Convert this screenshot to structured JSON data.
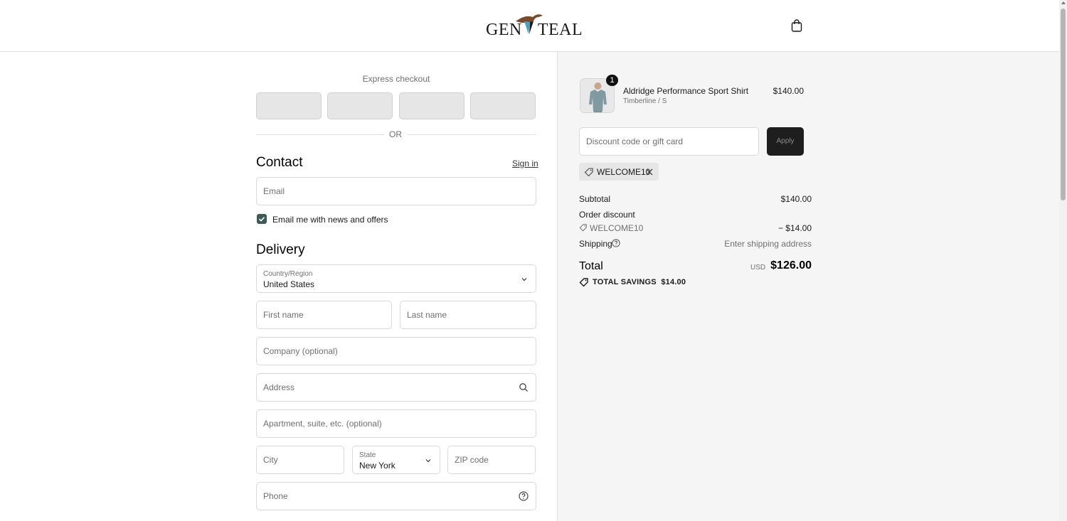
{
  "header": {
    "brand_left": "GEN",
    "brand_right": "TEAL"
  },
  "checkout": {
    "express_title": "Express checkout",
    "or_text": "OR",
    "contact": {
      "heading": "Contact",
      "signin_label": "Sign in",
      "email_placeholder": "Email",
      "newsletter_label": "Email me with news and offers",
      "newsletter_checked": true
    },
    "delivery": {
      "heading": "Delivery",
      "country_label": "Country/Region",
      "country_value": "United States",
      "first_name_placeholder": "First name",
      "last_name_placeholder": "Last name",
      "company_placeholder": "Company (optional)",
      "address_placeholder": "Address",
      "apartment_placeholder": "Apartment, suite, etc. (optional)",
      "city_placeholder": "City",
      "state_label": "State",
      "state_value": "New York",
      "zip_placeholder": "ZIP code",
      "phone_placeholder": "Phone"
    }
  },
  "summary": {
    "product": {
      "quantity": "1",
      "name": "Aldridge Performance Sport Shirt",
      "variant": "Timberline / S",
      "price": "$140.00"
    },
    "discount_placeholder": "Discount code or gift card",
    "apply_label": "Apply",
    "applied_code": "WELCOME10",
    "subtotal_label": "Subtotal",
    "subtotal_value": "$140.00",
    "order_discount_label": "Order discount",
    "discount_code": "WELCOME10",
    "discount_value": "− $14.00",
    "shipping_label": "Shipping",
    "shipping_value": "Enter shipping address",
    "total_label": "Total",
    "currency": "USD",
    "total_value": "$126.00",
    "savings_label": "TOTAL SAVINGS",
    "savings_value": "$14.00"
  },
  "colors": {
    "apply_button": "#1e1e1e",
    "checkbox": "#3d5a57",
    "logo_accent": "#4a9fc4",
    "logo_bird": "#7a4a2a"
  }
}
